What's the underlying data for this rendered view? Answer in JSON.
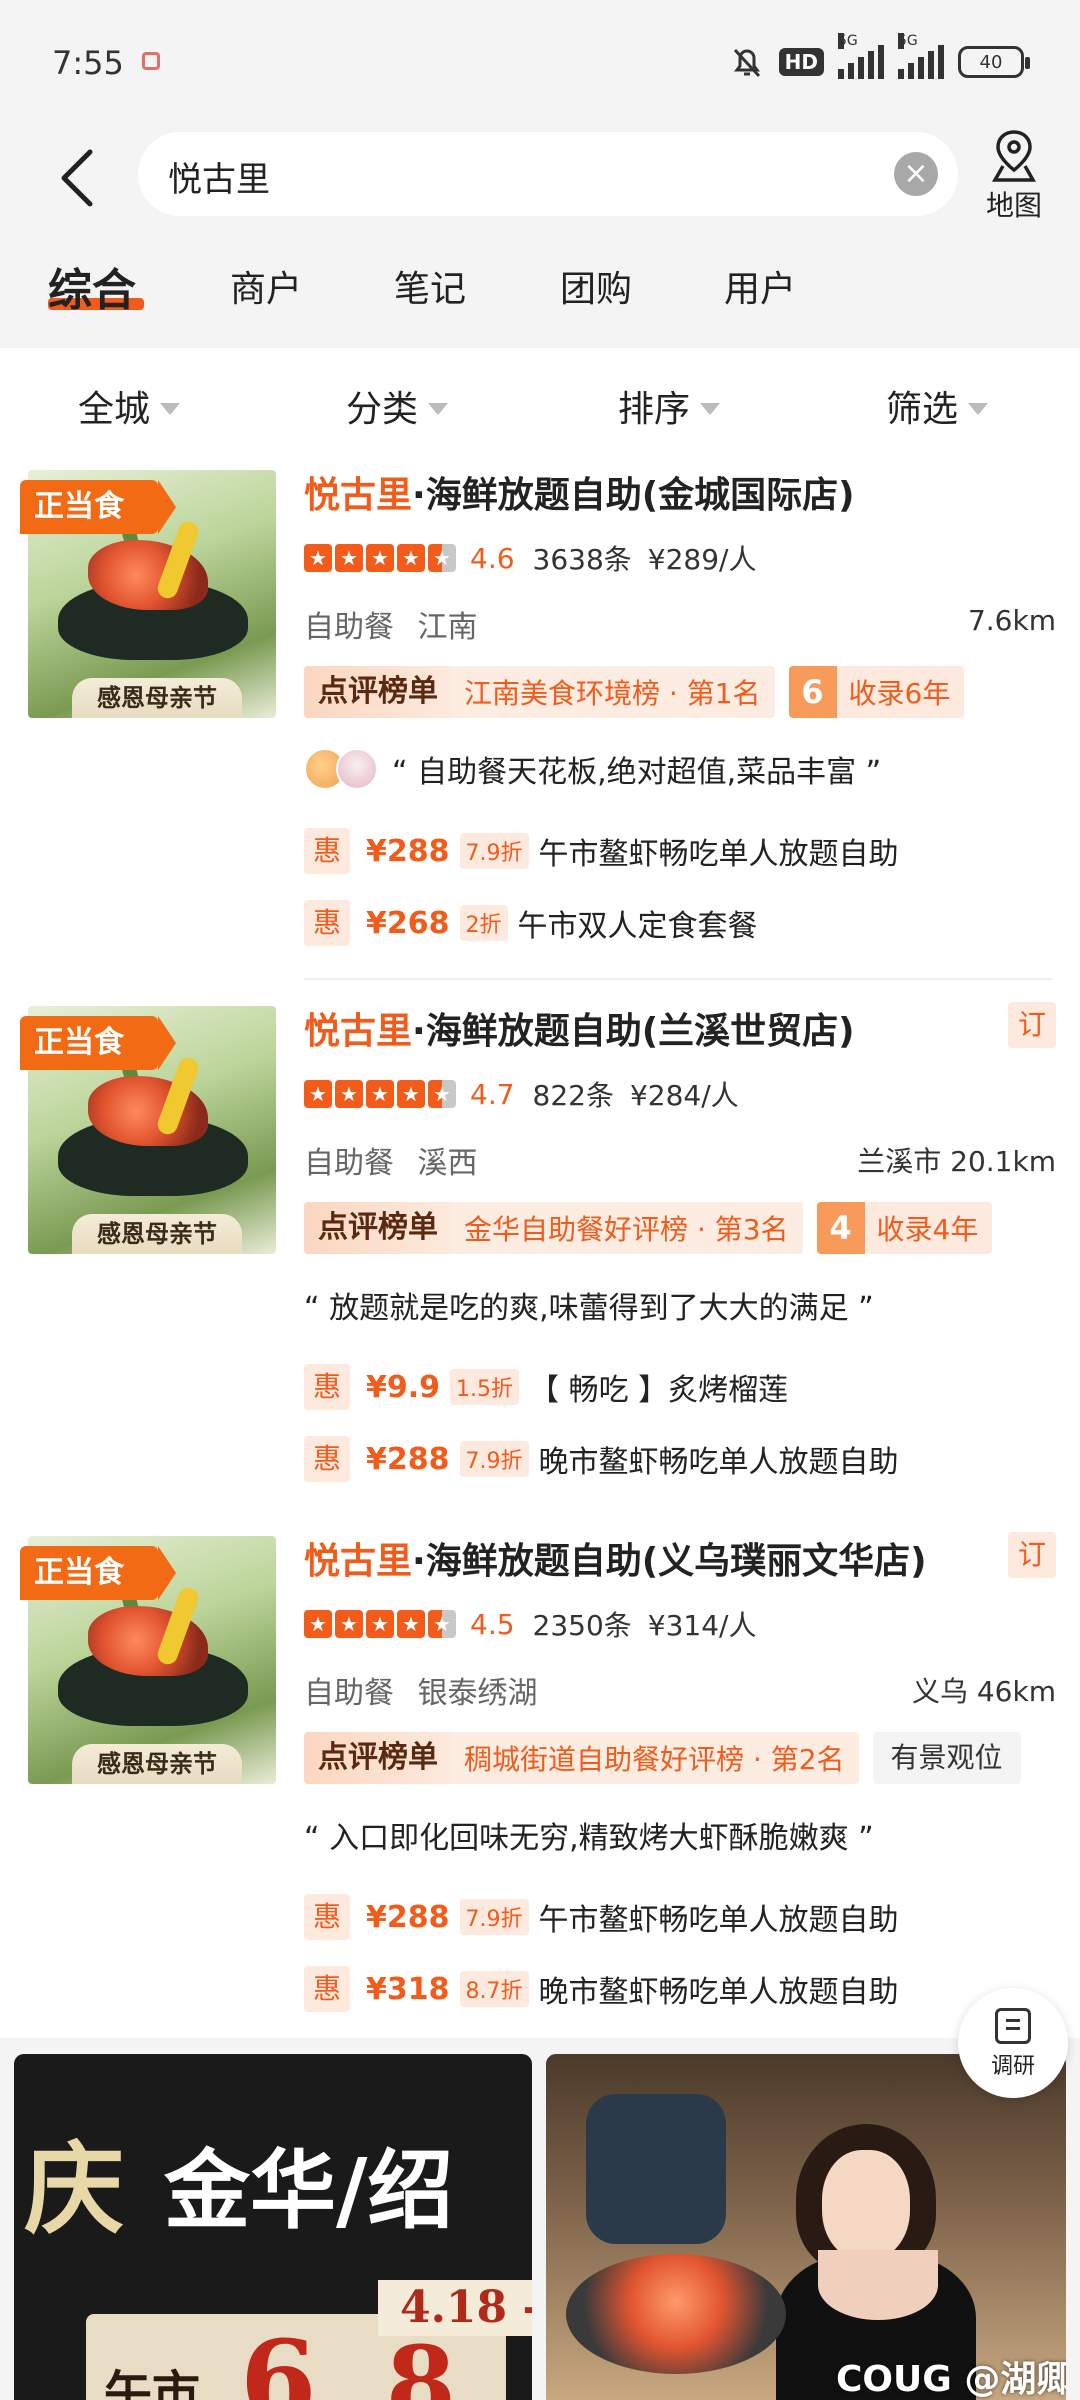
{
  "status_bar": {
    "time": "7:55",
    "hd_label": "HD",
    "net1": "5G",
    "net2": "5G",
    "battery": "40"
  },
  "search": {
    "query": "悦古里",
    "map_label": "地图"
  },
  "tabs": [
    "综合",
    "商户",
    "笔记",
    "团购",
    "用户"
  ],
  "filters": [
    "全城",
    "分类",
    "排序",
    "筛选"
  ],
  "colors": {
    "accent": "#f25b1a",
    "rank_bg": "#fdece2",
    "page_gray": "#f4f4f4"
  },
  "icons": {
    "back": "chevron-left-icon",
    "clear": "clear-icon",
    "map": "map-pin-icon",
    "survey": "survey-icon"
  },
  "shops": [
    {
      "ribbon": "正当食",
      "thumb_caption": "感恩母亲节",
      "name_highlight": "悦古里",
      "name_rest": "·海鲜放题自助(金城国际店)",
      "book_tag": "",
      "rating": "4.6",
      "stars": 4.5,
      "reviews": "3638条",
      "price": "¥289/人",
      "category": "自助餐",
      "district": "江南",
      "distance": "7.6km",
      "rank_brand": "点评榜单",
      "rank_text": "江南美食环境榜 · 第1名",
      "years_num": "6",
      "years_text": "收录6年",
      "feature": "",
      "quote": "“ 自助餐天花板,绝对超值,菜品丰富 ”",
      "has_avatars": true,
      "deals": [
        {
          "tag": "惠",
          "price": "¥288",
          "discount": "7.9折",
          "name": "午市鳌虾畅吃单人放题自助"
        },
        {
          "tag": "惠",
          "price": "¥268",
          "discount": "2折",
          "name": "午市双人定食套餐"
        }
      ]
    },
    {
      "ribbon": "正当食",
      "thumb_caption": "感恩母亲节",
      "name_highlight": "悦古里",
      "name_rest": "·海鲜放题自助(兰溪世贸店)",
      "book_tag": "订",
      "rating": "4.7",
      "stars": 4.5,
      "reviews": "822条",
      "price": "¥284/人",
      "category": "自助餐",
      "district": "溪西",
      "distance": "兰溪市 20.1km",
      "rank_brand": "点评榜单",
      "rank_text": "金华自助餐好评榜 · 第3名",
      "years_num": "4",
      "years_text": "收录4年",
      "feature": "",
      "quote": "“ 放题就是吃的爽,味蕾得到了大大的满足 ”",
      "has_avatars": false,
      "deals": [
        {
          "tag": "惠",
          "price": "¥9.9",
          "discount": "1.5折",
          "name": "【 畅吃 】炙烤榴莲"
        },
        {
          "tag": "惠",
          "price": "¥288",
          "discount": "7.9折",
          "name": "晚市鳌虾畅吃单人放题自助"
        }
      ]
    },
    {
      "ribbon": "正当食",
      "thumb_caption": "感恩母亲节",
      "name_highlight": "悦古里",
      "name_rest": "·海鲜放题自助(义乌璞丽文华店)",
      "book_tag": "订",
      "rating": "4.5",
      "stars": 4.5,
      "reviews": "2350条",
      "price": "¥314/人",
      "category": "自助餐",
      "district": "银泰绣湖",
      "distance": "义乌 46km",
      "rank_brand": "点评榜单",
      "rank_text": "稠城街道自助餐好评榜 · 第2名",
      "years_num": "",
      "years_text": "",
      "feature": "有景观位",
      "quote": "“ 入口即化回味无穷,精致烤大虾酥脆嫩爽 ”",
      "has_avatars": false,
      "deals": [
        {
          "tag": "惠",
          "price": "¥288",
          "discount": "7.9折",
          "name": "午市鳌虾畅吃单人放题自助"
        },
        {
          "tag": "惠",
          "price": "¥318",
          "discount": "8.7折",
          "name": "晚市鳌虾畅吃单人放题自助"
        }
      ]
    }
  ],
  "survey_label": "调研",
  "banners": {
    "left_qing": "庆",
    "left_headline": "金华/绍",
    "left_date": "4.18 -",
    "left_lower": "午市",
    "left_num1": "6",
    "left_num2": "8",
    "right_watermark": "COUG @湖卿"
  }
}
